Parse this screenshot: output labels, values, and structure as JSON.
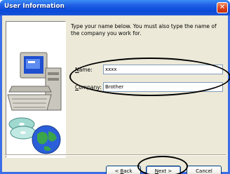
{
  "dialog": {
    "title": "User Information",
    "close_glyph": "✕"
  },
  "instructions": "Type your name below. You must also type the name of the company you work for.",
  "form": {
    "name_label_accel": "N",
    "name_label_rest": "ame:",
    "name_value": "xxxx",
    "company_label_accel": "C",
    "company_label_rest": "ompany:",
    "company_value": "Brother"
  },
  "buttons": {
    "back_pre": "< ",
    "back_accel": "B",
    "back_rest": "ack",
    "next_accel": "N",
    "next_rest": "ext >",
    "cancel": "Cancel"
  },
  "icons": {
    "close": "close-icon",
    "computer": "computer-icon",
    "cds": "cd-icon",
    "globe": "globe-icon"
  }
}
